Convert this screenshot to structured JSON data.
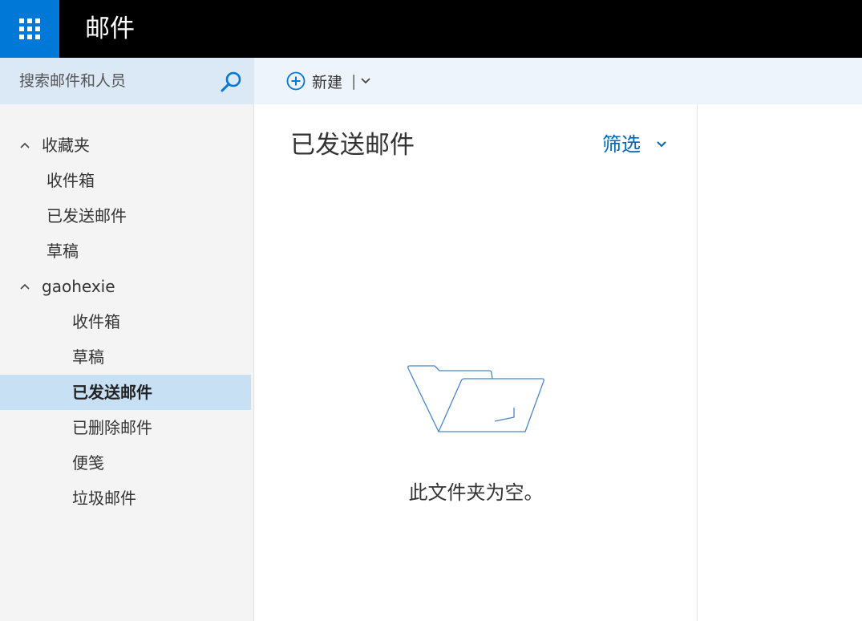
{
  "app": {
    "title": "邮件"
  },
  "search": {
    "placeholder": "搜索邮件和人员"
  },
  "toolbar": {
    "new_label": "新建",
    "separator": "|"
  },
  "sidebar": {
    "favorites": {
      "label": "收藏夹",
      "items": [
        {
          "label": "收件箱"
        },
        {
          "label": "已发送邮件"
        },
        {
          "label": "草稿"
        }
      ]
    },
    "account": {
      "label": "gaohexie",
      "items": [
        {
          "label": "收件箱",
          "selected": false
        },
        {
          "label": "草稿",
          "selected": false
        },
        {
          "label": "已发送邮件",
          "selected": true
        },
        {
          "label": "已删除邮件",
          "selected": false
        },
        {
          "label": "便笺",
          "selected": false
        },
        {
          "label": "垃圾邮件",
          "selected": false
        }
      ]
    }
  },
  "list": {
    "title": "已发送邮件",
    "filter_label": "筛选",
    "empty_message": "此文件夹为空。"
  },
  "icons": {
    "waffle": "app-launcher-icon",
    "search": "search-icon",
    "new": "plus-circle-icon",
    "collapse": "chevron-up-icon",
    "dropdown": "chevron-down-icon",
    "empty": "empty-folder-icon"
  },
  "colors": {
    "accent": "#0078d7",
    "topbar": "#000000",
    "selected_bg": "#c7e0f4",
    "link": "#0066b4"
  }
}
